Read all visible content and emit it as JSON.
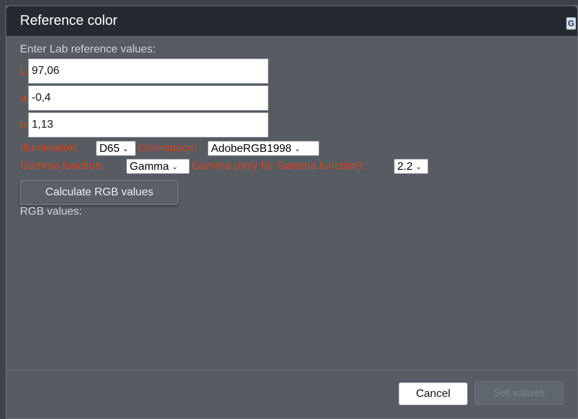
{
  "dialog": {
    "title": "Reference color",
    "corner_icon_glyph": "G"
  },
  "lab": {
    "heading": "Enter Lab reference values:",
    "L": {
      "label": "L:",
      "value": "97,06"
    },
    "a": {
      "label": "a:",
      "value": "-0,4"
    },
    "b": {
      "label": "b:",
      "value": "1,13"
    }
  },
  "options": {
    "illumination_label": "Illumination:",
    "illumination_value": "D65",
    "colorspace_label": "Colorspace:",
    "colorspace_value": "AdobeRGB1998",
    "gamma_function_label": "Gamma function:",
    "gamma_function_value": "Gamma",
    "gamma_label": "Gamma (only for Gamma function):",
    "gamma_value": "2.2"
  },
  "actions": {
    "calculate_label": "Calculate RGB values",
    "rgb_values_label": "RGB values:",
    "cancel_label": "Cancel",
    "set_values_label": "Set values"
  },
  "colors": {
    "label_accent": "#d2451e",
    "titlebar": "#262a30",
    "panel": "#575c63"
  }
}
